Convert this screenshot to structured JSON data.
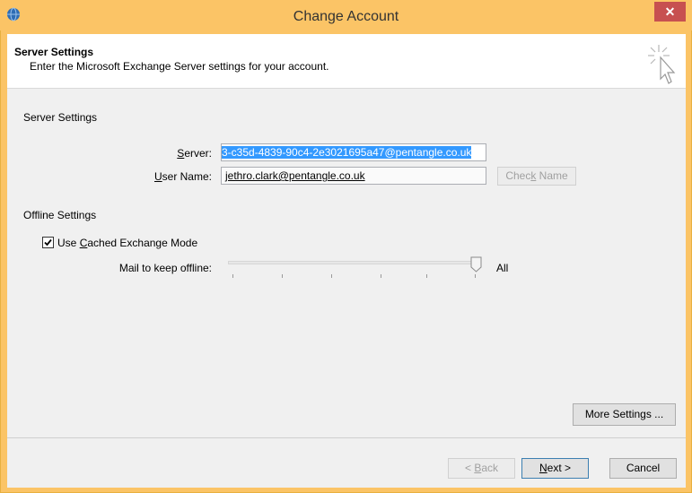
{
  "window": {
    "title": "Change Account",
    "close_glyph": "✕"
  },
  "header": {
    "title": "Server Settings",
    "description": "Enter the Microsoft Exchange Server settings for your account."
  },
  "server_settings": {
    "section_label": "Server Settings",
    "server_label": "Server:",
    "server_value": "3-c35d-4839-90c4-2e3021695a47@pentangle.co.uk",
    "username_label": "User Name:",
    "username_value": "jethro.clark@pentangle.co.uk",
    "check_name_label": "Check Name"
  },
  "offline_settings": {
    "section_label": "Offline Settings",
    "cached_mode_label": "Use Cached Exchange Mode",
    "cached_mode_checked": true,
    "mail_offline_label": "Mail to keep offline:",
    "mail_offline_value": "All",
    "slider_fraction": 1.0
  },
  "buttons": {
    "more_settings": "More Settings ...",
    "back": "< Back",
    "next": "Next >",
    "cancel": "Cancel"
  },
  "colors": {
    "titlebar": "#fbc466",
    "close": "#c75050",
    "selection": "#3399ff"
  }
}
